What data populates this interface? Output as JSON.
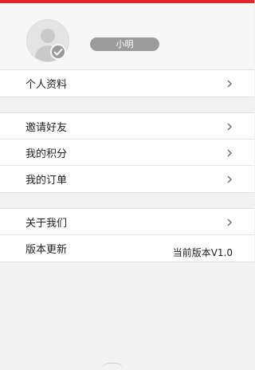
{
  "profile": {
    "username": "小明"
  },
  "groups": [
    {
      "items": [
        {
          "label": "个人资料"
        }
      ]
    },
    {
      "items": [
        {
          "label": "邀请好友"
        },
        {
          "label": "我的积分"
        },
        {
          "label": "我的订单"
        }
      ]
    },
    {
      "items": [
        {
          "label": "关于我们"
        },
        {
          "label": "版本更新",
          "value": "当前版本V1.0"
        }
      ]
    }
  ],
  "colors": {
    "top_bar": "#e3262b",
    "pill": "#9b9b9b",
    "background": "#f2f2f2"
  },
  "icons": {
    "avatar": "user-silhouette-icon",
    "verified": "check-badge-icon",
    "row": "chevron-right-icon"
  }
}
